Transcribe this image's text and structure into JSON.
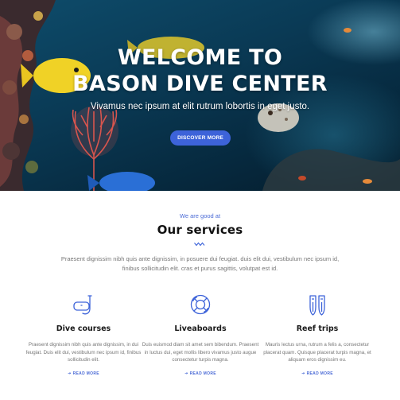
{
  "hero": {
    "title_line1": "WELCOME TO",
    "title_line2": "BASON DIVE CENTER",
    "subtitle": "Vivamus nec ipsum at elit rutrum lobortis in eget justo.",
    "button_label": "DISCOVER MORE"
  },
  "services": {
    "eyebrow": "We are good at",
    "title": "Our services",
    "intro": "Praesent dignissim nibh quis ante dignissim, in posuere dui feugiat. duis elit dui, vestibulum nec ipsum id, finibus sollicitudin elit. cras et purus sagittis, volutpat est id.",
    "items": [
      {
        "icon": "snorkel-mask-icon",
        "title": "Dive courses",
        "text": "Praesent dignissim nibh quis ante dignissim, in dui feugiat. Duis elit dui, vestibulum nec ipsum id, finibus sollicitudin elit.",
        "link": "READ MORE"
      },
      {
        "icon": "life-ring-icon",
        "title": "Liveaboards",
        "text": "Duis euismod diam sit amet sem bibendum. Praesent in luctus dui, eget mollis libero vivamus justo augue consectetur turpis magna.",
        "link": "READ MORE"
      },
      {
        "icon": "fins-icon",
        "title": "Reef trips",
        "text": "Mauris lectus urna, rutrum a felis a, consectetur placerat quam. Quisque placerat turpis magna, et aliquam eros dignissim eu.",
        "link": "READ MORE"
      }
    ]
  },
  "colors": {
    "accent": "#3d63d9",
    "ocean_dark": "#06283d",
    "text_muted": "#777777"
  }
}
